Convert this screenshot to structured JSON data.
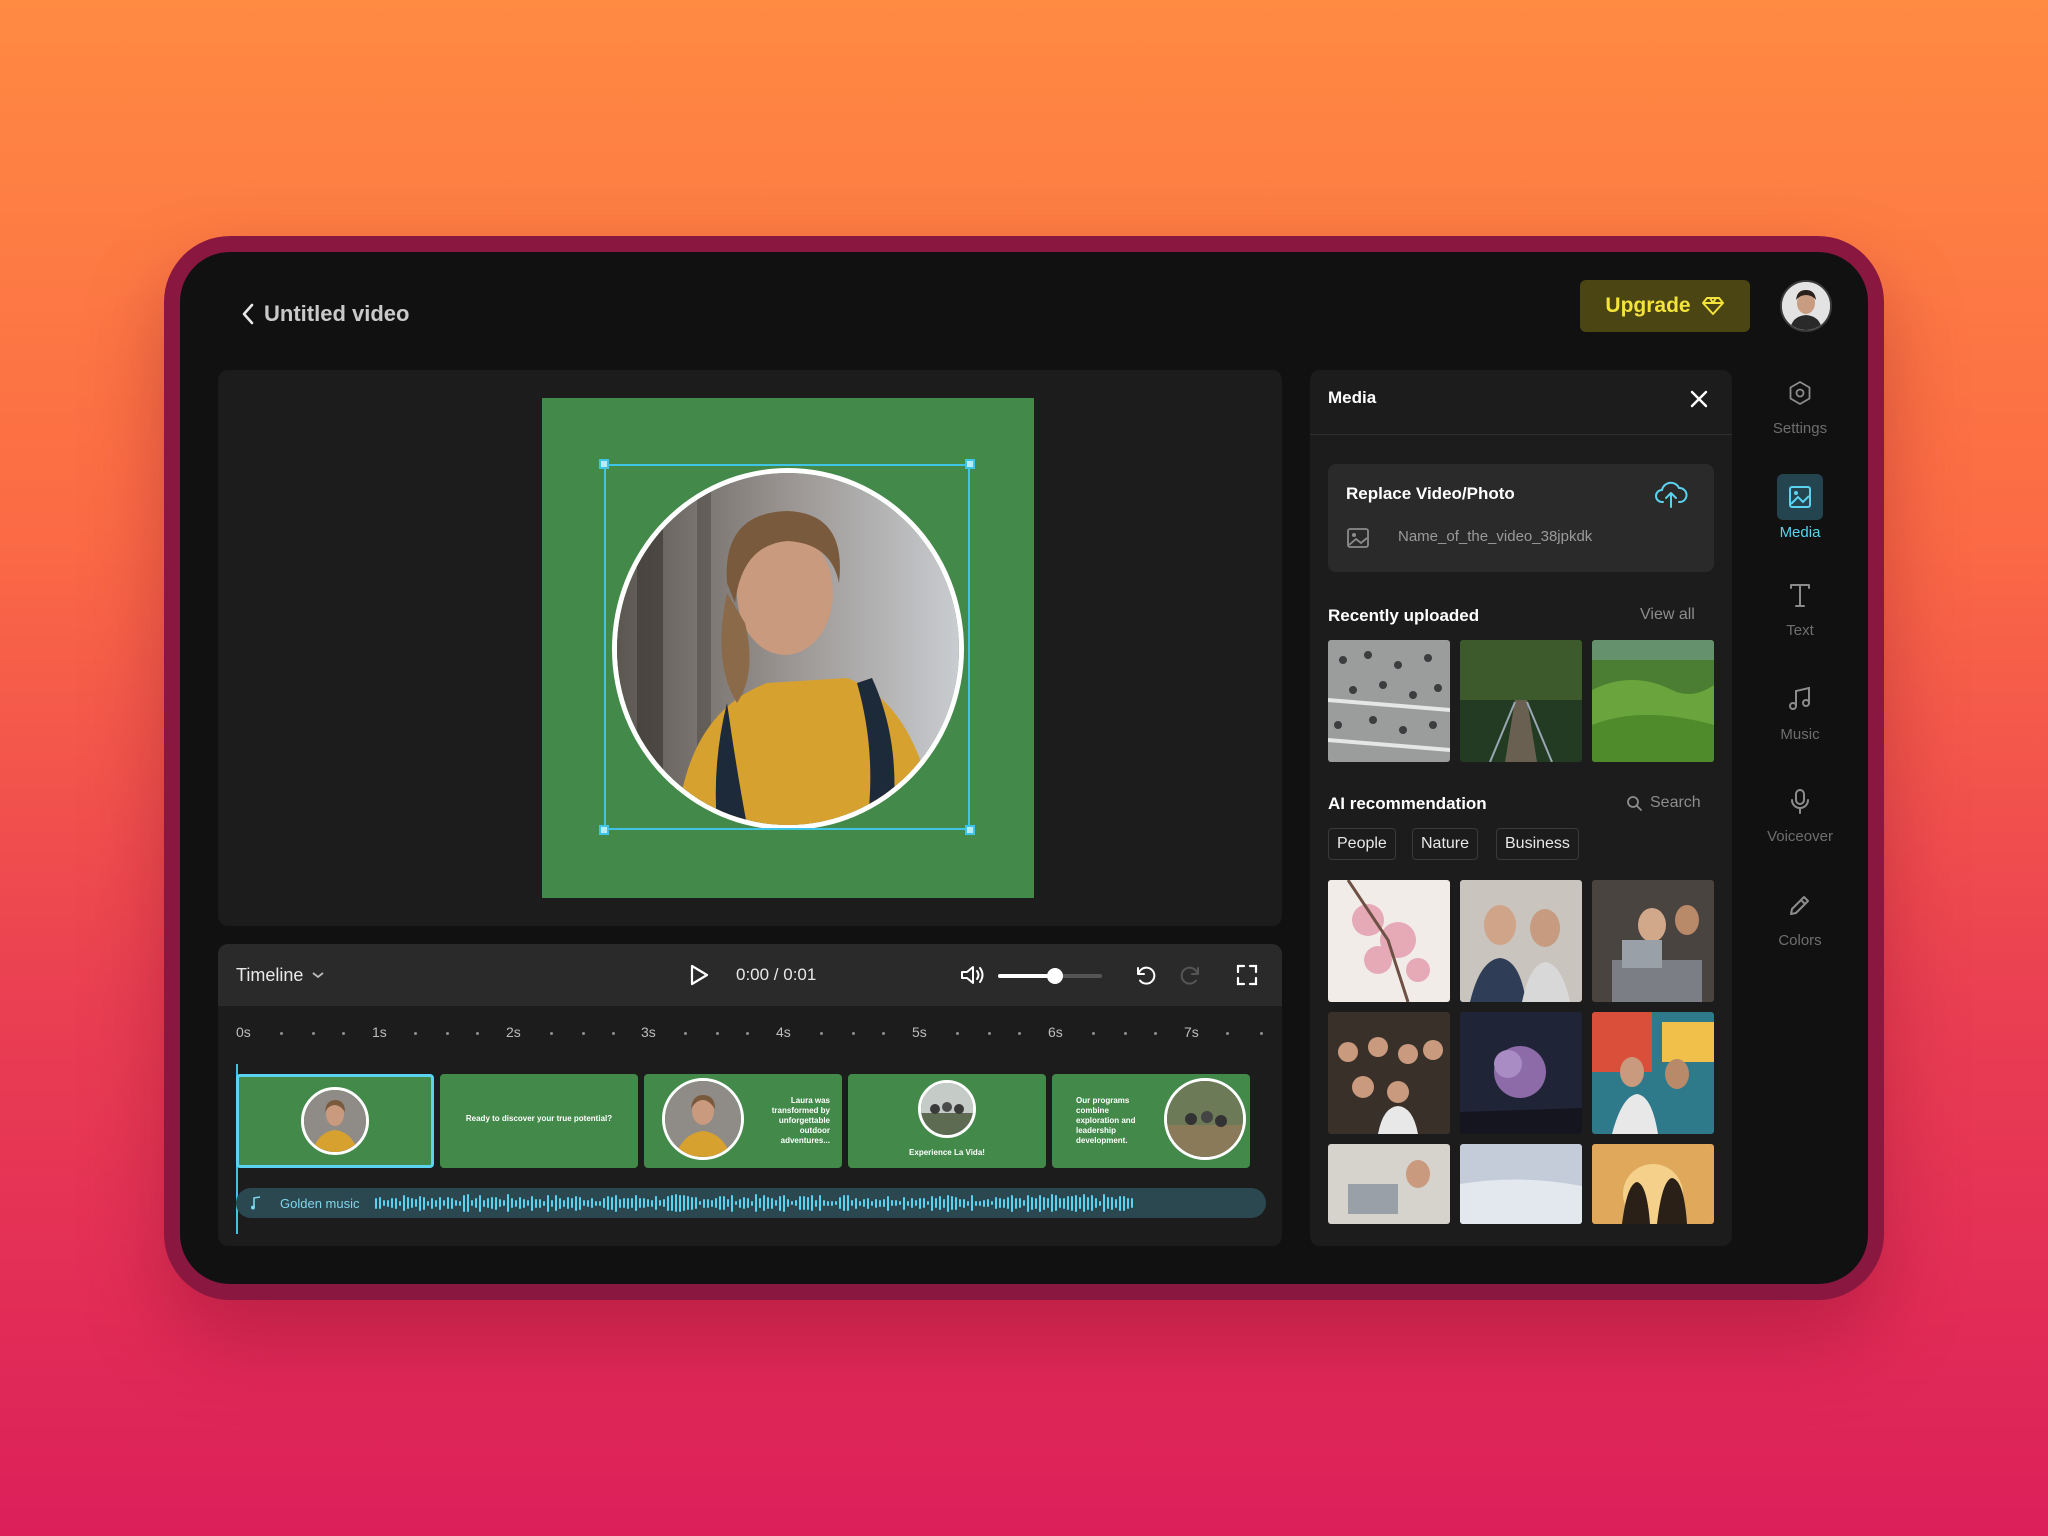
{
  "header": {
    "title": "Untitled video",
    "upgrade_label": "Upgrade"
  },
  "timeline": {
    "label": "Timeline",
    "time": "0:00 / 0:01",
    "volume_level": 0.55,
    "ruler": [
      "0s",
      "1s",
      "2s",
      "3s",
      "4s",
      "5s",
      "6s",
      "7s"
    ],
    "clips": [
      {
        "text": ""
      },
      {
        "text": "Ready to discover your true potential?"
      },
      {
        "text": "Laura was transformed by unforgettable outdoor adventures..."
      },
      {
        "text": "Experience La Vida!"
      },
      {
        "text": "Our programs combine exploration and leadership development."
      }
    ],
    "audio_label": "Golden music"
  },
  "media": {
    "title": "Media",
    "replace_title": "Replace Video/Photo",
    "file_name": "Name_of_the_video_38jpkdk",
    "recent_title": "Recently uploaded",
    "view_all": "View all",
    "ai_title": "AI recommendation",
    "search_placeholder": "Search",
    "chips": [
      "People",
      "Nature",
      "Business"
    ]
  },
  "rail": {
    "items": [
      {
        "label": "Settings",
        "icon": "settings-icon"
      },
      {
        "label": "Media",
        "icon": "image-icon",
        "active": true
      },
      {
        "label": "Text",
        "icon": "text-icon"
      },
      {
        "label": "Music",
        "icon": "music-icon"
      },
      {
        "label": "Voiceover",
        "icon": "microphone-icon"
      },
      {
        "label": "Colors",
        "icon": "pencil-icon"
      }
    ]
  },
  "colors": {
    "accent": "#5ad2f0",
    "canvas_green": "#43894a",
    "upgrade_text": "#f3e33a"
  }
}
